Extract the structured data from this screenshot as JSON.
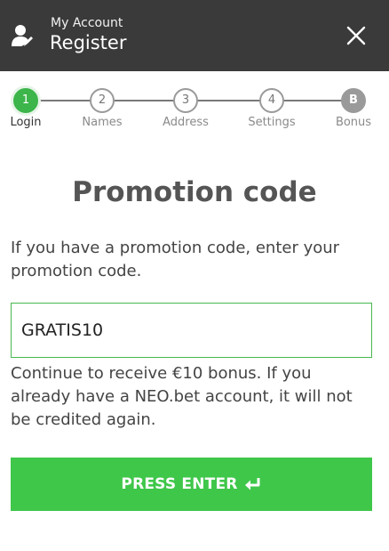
{
  "header": {
    "subtitle": "My Account",
    "title": "Register",
    "background": "#3a3a3a"
  },
  "stepper": {
    "steps": [
      {
        "number": "1",
        "label": "Login",
        "state": "active"
      },
      {
        "number": "2",
        "label": "Names",
        "state": "pending"
      },
      {
        "number": "3",
        "label": "Address",
        "state": "pending"
      },
      {
        "number": "4",
        "label": "Settings",
        "state": "pending"
      },
      {
        "number": "B",
        "label": "Bonus",
        "state": "pending"
      }
    ],
    "active_color": "#3cb54a"
  },
  "main": {
    "title": "Promotion code",
    "intro": "If you have a promotion code, enter your promotion code.",
    "promo_input": {
      "value": "GRATIS10",
      "placeholder": ""
    },
    "help": "Continue to receive €10 bonus. If you already have a NEO.bet account, it will not be credited again.",
    "submit_label": "PRESS ENTER",
    "submit_color": "#3fc74a"
  },
  "icons": {
    "user": "user-icon",
    "close": "close-icon",
    "enter": "enter-arrow-icon"
  }
}
